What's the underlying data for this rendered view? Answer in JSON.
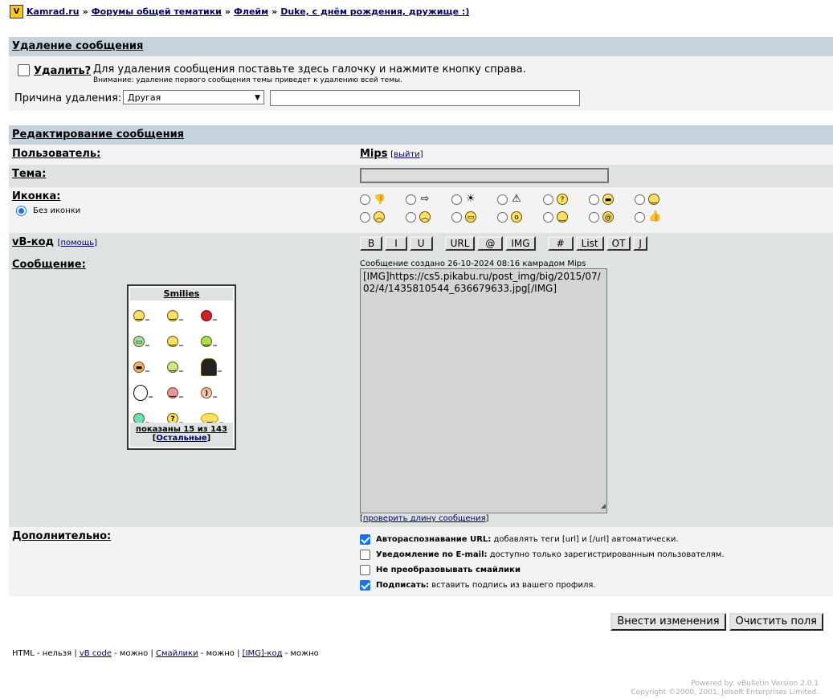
{
  "breadcrumb": {
    "logo_letter": "V",
    "items": [
      "Kamrad.ru",
      "Форумы общей тематики",
      "Флейм",
      "Duke, с днём рождения, дружище :)"
    ],
    "separator": "»"
  },
  "delete_section": {
    "header": "Удаление сообщения",
    "checkbox_label": "Удалить?",
    "instruction": "Для удаления сообщения поставьте здесь галочку и нажмите кнопку справа.",
    "warning": "Внимание: удаление первого сообщения темы приведет к удалению всей темы.",
    "reason_label": "Причина удаления:",
    "reason_selected": "Другая",
    "reason_text": ""
  },
  "edit_section": {
    "header": "Редактирование сообщения",
    "user_label": "Пользователь:",
    "user_name": "Mips",
    "logout_link": "выйти",
    "topic_label": "Тема:",
    "topic_value": "",
    "icon_label": "Иконка:",
    "no_icon_label": "Без иконки",
    "icons": [
      "thumbs-down-icon",
      "arrow-right-icon",
      "lightbulb-icon",
      "warning-icon",
      "question-icon",
      "cool-icon",
      "smile-icon",
      "angry-icon",
      "sad-icon",
      "grin-icon",
      "surprised-icon",
      "happy-icon",
      "dizzy-icon",
      "thumbs-up-icon"
    ],
    "vbcode_label": "vB-код",
    "help_link": "помощь",
    "buttons_group1": [
      "B",
      "I",
      "U"
    ],
    "buttons_group2": [
      "URL",
      "@",
      "IMG"
    ],
    "buttons_group3": [
      "#",
      "List",
      "OT",
      "J"
    ],
    "message_label": "Сообщение:",
    "created_info": "Сообщение создано 26-10-2024 08:16 камрадом Mips",
    "message_text": "[IMG]https://cs5.pikabu.ru/post_img/big/2015/07/02/4/1435810544_636679633.jpg[/IMG]",
    "check_length_link": "проверить длину сообщения",
    "smilies": {
      "title": "Smilies",
      "shown": "показаны 15 из 143",
      "others": "Остальные"
    },
    "extra_label": "Дополнительно:",
    "options": [
      {
        "title": "Автораспознавание URL:",
        "desc": "добавлять теги [url] и [/url] автоматически.",
        "checked": true
      },
      {
        "title": "Уведомление по E-mail:",
        "desc": "доступно только зарегистрированным пользователям.",
        "checked": false
      },
      {
        "title": "Не преобразовывать смайлики",
        "desc": "",
        "checked": false
      },
      {
        "title": "Подписать:",
        "desc": "вставить подпись из вашего профиля.",
        "checked": true
      }
    ]
  },
  "actions": {
    "submit": "Внести изменения",
    "reset": "Очистить поля"
  },
  "footer": {
    "html_label": "HTML",
    "html_status": "- нельзя",
    "vbcode_link": "vB code",
    "vbcode_status": "- можно",
    "smilies_link": "Смайлики",
    "smilies_status": "- можно",
    "img_link": "[IMG]-код",
    "img_status": "- можно",
    "separator": "|",
    "powered_line1": "Powered by: vBulletin Version 2.0.1",
    "powered_line2": "Copyright ©2000, 2001, Jelsoft Enterprises Limited."
  }
}
